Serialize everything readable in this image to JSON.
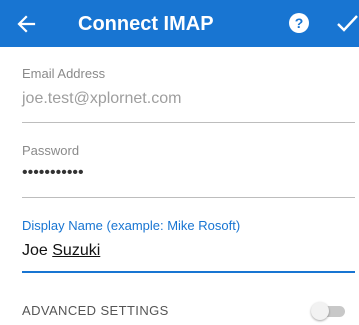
{
  "app_bar": {
    "title": "Connect IMAP",
    "back_icon": "arrow-left-icon",
    "help_icon": "help-circle-icon",
    "confirm_icon": "checkmark-icon",
    "background_color": "#1875d2"
  },
  "form": {
    "email": {
      "label": "Email Address",
      "value": "joe.test@xplornet.com"
    },
    "password": {
      "label": "Password",
      "value": "•••••••••••"
    },
    "display_name": {
      "label": "Display Name (example: Mike Rosoft)",
      "value_first": "Joe ",
      "value_last": "Suzuki"
    }
  },
  "advanced": {
    "label": "ADVANCED SETTINGS",
    "toggle_on": false
  }
}
